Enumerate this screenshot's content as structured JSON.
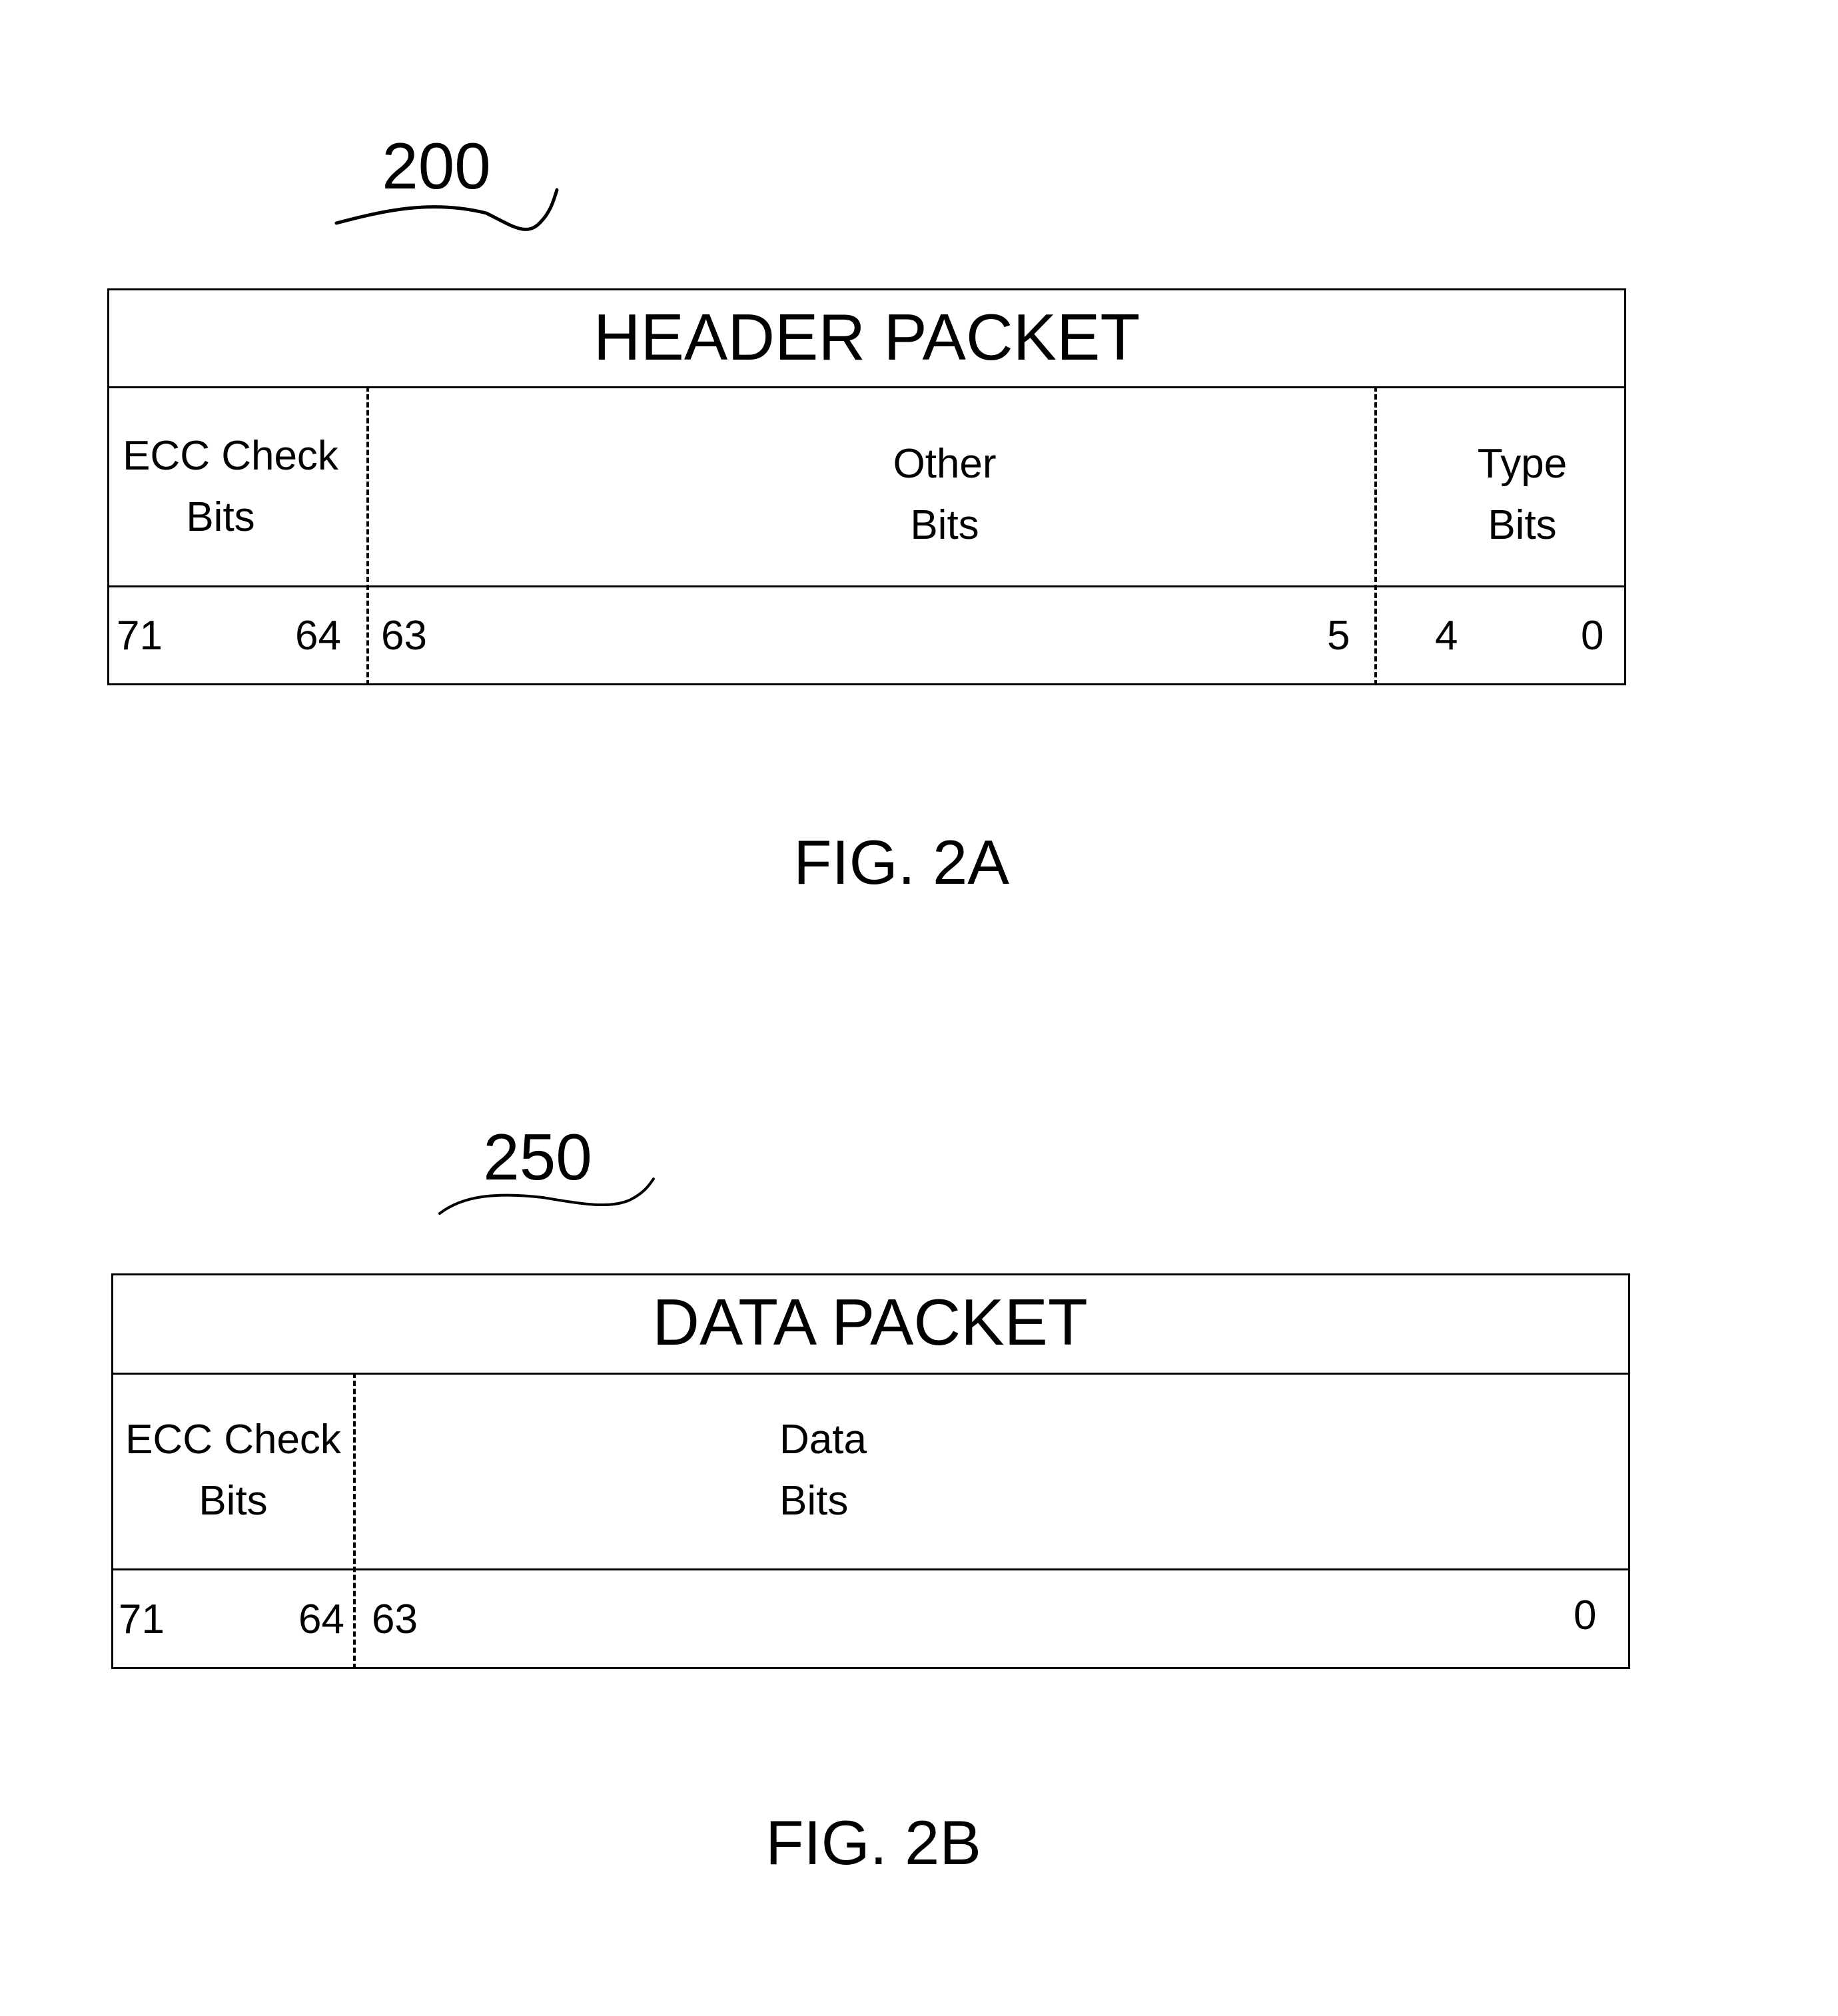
{
  "figure_a": {
    "reference": "200",
    "caption": "FIG. 2A",
    "title": "HEADER PACKET",
    "fields": [
      {
        "name": "ECC Check",
        "name2": "Bits",
        "msb": "71",
        "lsb": "64"
      },
      {
        "name": "Other",
        "name2": "Bits",
        "msb": "63",
        "lsb": "5"
      },
      {
        "name": "Type",
        "name2": "Bits",
        "msb": "4",
        "lsb": "0"
      }
    ]
  },
  "figure_b": {
    "reference": "250",
    "caption": "FIG. 2B",
    "title": "DATA PACKET",
    "fields": [
      {
        "name": "ECC Check",
        "name2": "Bits",
        "msb": "71",
        "lsb": "64"
      },
      {
        "name": "Data",
        "name2": "Bits",
        "msb": "63",
        "lsb": "0"
      }
    ]
  }
}
